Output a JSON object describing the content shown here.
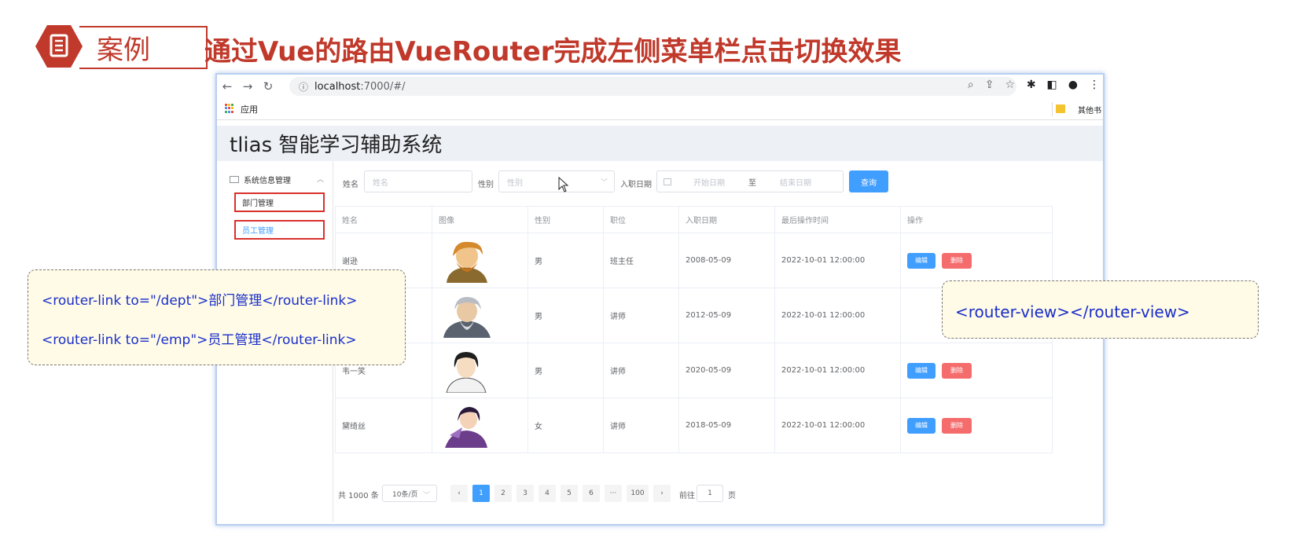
{
  "slide": {
    "case_label": "案例",
    "title": "通过Vue的路由VueRouter完成左侧菜单栏点击切换效果"
  },
  "browser": {
    "url_host": "localhost",
    "url_path": ":7000/#/",
    "bookmarks": {
      "apps": "应用",
      "other": "其他书"
    }
  },
  "app": {
    "title": "tlias 智能学习辅助系统",
    "sidebar": {
      "group_title": "系统信息管理",
      "items": [
        {
          "label": "部门管理"
        },
        {
          "label": "员工管理"
        }
      ]
    },
    "search": {
      "name_label": "姓名",
      "name_placeholder": "姓名",
      "gender_label": "性别",
      "gender_placeholder": "性别",
      "date_label": "入职日期",
      "start_placeholder": "开始日期",
      "to": "至",
      "end_placeholder": "结束日期",
      "query_button": "查询"
    },
    "table": {
      "headers": [
        "姓名",
        "图像",
        "性别",
        "职位",
        "入职日期",
        "最后操作时间",
        "操作"
      ],
      "rows": [
        {
          "name": "谢逊",
          "gender": "男",
          "position": "班主任",
          "entry_date": "2008-05-09",
          "updated": "2022-10-01 12:00:00"
        },
        {
          "name": "",
          "gender": "男",
          "position": "讲师",
          "entry_date": "2012-05-09",
          "updated": "2022-10-01 12:00:00"
        },
        {
          "name": "韦一笑",
          "gender": "男",
          "position": "讲师",
          "entry_date": "2020-05-09",
          "updated": "2022-10-01 12:00:00"
        },
        {
          "name": "黛绮丝",
          "gender": "女",
          "position": "讲师",
          "entry_date": "2018-05-09",
          "updated": "2022-10-01 12:00:00"
        }
      ],
      "edit_label": "编辑",
      "delete_label": "删除"
    },
    "pagination": {
      "total": "共 1000 条",
      "page_size": "10条/页",
      "pages": [
        "1",
        "2",
        "3",
        "4",
        "5",
        "6",
        "···",
        "100"
      ],
      "current_page": "1",
      "goto_label": "前往",
      "goto_value": "1",
      "page_suffix": "页"
    }
  },
  "callouts": {
    "left_line1": "<router-link to=\"/dept\">部门管理</router-link>",
    "left_line2": "<router-link to=\"/emp\">员工管理</router-link>",
    "right_line": "<router-view></router-view>"
  },
  "colors": {
    "accent_red": "#c0392b",
    "primary_blue": "#409eff",
    "danger": "#f56c6c",
    "callout_text": "#1a2fc9",
    "callout_bg": "#fffbe6"
  }
}
